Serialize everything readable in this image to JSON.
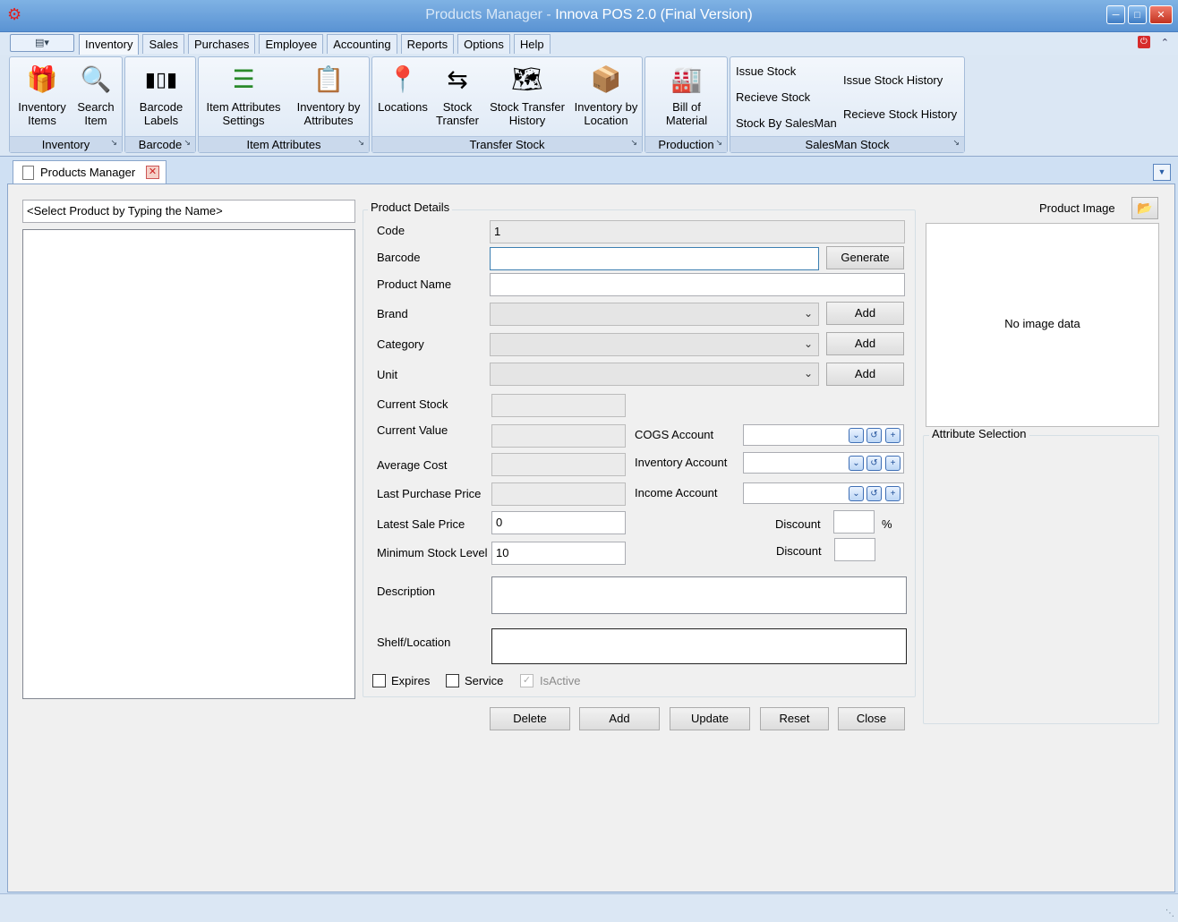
{
  "window": {
    "title_dim": "Products Manager - ",
    "title_main": "Innova POS 2.0  (Final Version)",
    "app_icon": "robot-icon"
  },
  "menu": {
    "tabs": [
      "Inventory",
      "Sales",
      "Purchases",
      "Employee",
      "Accounting",
      "Reports",
      "Options",
      "Help"
    ],
    "active_tab": "Inventory"
  },
  "ribbon": {
    "inventory_items": "Inventory Items",
    "search_item": "Search Item",
    "barcode_labels": "Barcode Labels",
    "item_attr_settings": "Item Attributes Settings",
    "inventory_by_attr": "Inventory by Attributes",
    "locations": "Locations",
    "stock_transfer": "Stock Transfer",
    "stock_transfer_history": "Stock Transfer History",
    "inventory_by_location": "Inventory by Location",
    "bill_of_material": "Bill of Material",
    "issue_stock": "Issue Stock",
    "recieve_stock": "Recieve Stock",
    "stock_by_salesman": "Stock By SalesMan",
    "issue_stock_history": "Issue Stock History",
    "recieve_stock_history": "Recieve Stock History",
    "groups": {
      "inventory": "Inventory",
      "barcode": "Barcode",
      "item_attributes": "Item Attributes",
      "transfer_stock": "Transfer Stock",
      "production": "Production",
      "salesman_stock": "SalesMan Stock"
    }
  },
  "doc_tab": {
    "label": "Products Manager"
  },
  "left": {
    "search_value": "<Select Product by Typing the Name>"
  },
  "details": {
    "title": "Product Details",
    "code_label": "Code",
    "code_value": "1",
    "barcode_label": "Barcode",
    "barcode_value": "",
    "generate_button": "Generate",
    "name_label": "Product Name",
    "name_value": "",
    "brand_label": "Brand",
    "category_label": "Category",
    "unit_label": "Unit",
    "add_label": "Add",
    "current_stock_label": "Current Stock",
    "current_value_label": "Current Value",
    "average_cost_label": "Average Cost",
    "last_purchase_label": "Last Purchase Price",
    "latest_sale_label": "Latest Sale Price",
    "latest_sale_value": "0",
    "min_stock_label": "Minimum Stock Level",
    "min_stock_value": "10",
    "cogs_label": "COGS Account",
    "inventory_account_label": "Inventory Account",
    "income_label": "Income Account",
    "discount_label": "Discount",
    "percent": "%",
    "description_label": "Description",
    "shelf_label": "Shelf/Location",
    "expires_label": "Expires",
    "service_label": "Service",
    "isactive_label": "IsActive"
  },
  "actions": {
    "delete": "Delete",
    "add": "Add",
    "update": "Update",
    "reset": "Reset",
    "close": "Close"
  },
  "image": {
    "title": "Product Image",
    "no_data": "No image data",
    "attribute_title": "Attribute Selection"
  }
}
